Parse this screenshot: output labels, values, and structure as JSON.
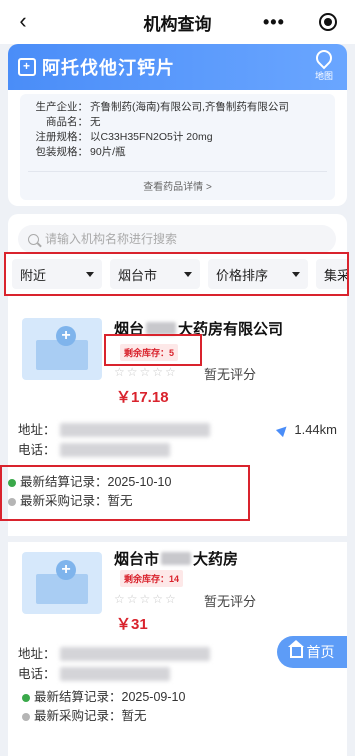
{
  "navbar": {
    "title": "机构查询",
    "back_icon": "chevron-left-icon",
    "more_label": "•••"
  },
  "drug": {
    "name": "阿托伐他汀钙片",
    "map_label": "地图",
    "fields": [
      {
        "key": "生产企业：",
        "value": "齐鲁制药(海南)有限公司,齐鲁制药有限公司"
      },
      {
        "key": "商品名：",
        "value": "无"
      },
      {
        "key": "注册规格：",
        "value": "以C33H35FN2O5计 20mg"
      },
      {
        "key": "包装规格：",
        "value": "90片/瓶"
      }
    ],
    "detail_link": "查看药品详情 >"
  },
  "search": {
    "placeholder": "请输入机构名称进行搜索"
  },
  "filters": [
    {
      "label": "附近"
    },
    {
      "label": "烟台市"
    },
    {
      "label": "价格排序"
    },
    {
      "label": "集采"
    }
  ],
  "stores": [
    {
      "name_prefix": "烟台",
      "name_suffix": "大药房有限公司",
      "stock": "剩余库存：5",
      "stars": "☆☆☆☆☆",
      "rating": "暂无评分",
      "price": "￥17.18",
      "address_label": "地址：",
      "phone_label": "电话：",
      "distance": "1.44km",
      "settle_record": "最新结算记录：2025-10-10",
      "purchase_record": "最新采购记录：暂无"
    },
    {
      "name_prefix": "烟台市",
      "name_suffix": "大药房",
      "stock": "剩余库存：14",
      "stars": "☆☆☆☆☆",
      "rating": "暂无评分",
      "price": "￥31",
      "address_label": "地址：",
      "phone_label": "电话：",
      "settle_record": "最新结算记录：2025-09-10",
      "purchase_record": "最新采购记录：暂无"
    }
  ],
  "home_button": {
    "label": "首页"
  },
  "colors": {
    "accent": "#4a8df8",
    "highlight": "#d9232d",
    "price": "#d9232d"
  }
}
